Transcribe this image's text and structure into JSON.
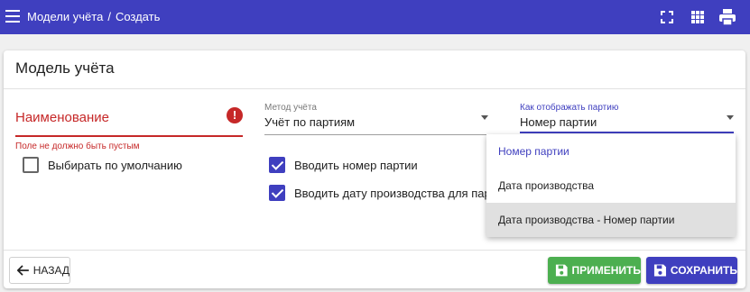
{
  "header": {
    "breadcrumb": [
      "Модели учёта",
      "Создать"
    ],
    "breadcrumb_separator": "/",
    "icons": [
      "menu-icon",
      "fullscreen-icon",
      "apps-grid-icon",
      "print-icon"
    ],
    "bar_color": "#3f3fbf"
  },
  "card": {
    "title": "Модель учёта"
  },
  "form": {
    "name_label": "Наименование",
    "name_value": "",
    "name_error": "Поле не должно быть пустым",
    "default_checkbox": {
      "label": "Выбирать по умолчанию",
      "checked": false
    },
    "method": {
      "caption": "Метод учёта",
      "value": "Учёт по партиям"
    },
    "batch_number_checkbox": {
      "label": "Вводить номер партии",
      "checked": true
    },
    "production_date_checkbox": {
      "label": "Вводить дату производства для партии",
      "checked": true
    },
    "display": {
      "caption": "Как отображать партию",
      "value": "Номер партии"
    },
    "display_options": [
      "Номер партии",
      "Дата производства",
      "Дата производства - Номер партии"
    ],
    "display_selected_index": 0,
    "display_highlighted_index": 2
  },
  "footer": {
    "back_label": "НАЗАД",
    "apply_label": "ПРИМЕНИТЬ",
    "save_label": "СОХРАНИТЬ"
  },
  "colors": {
    "accent": "#3f3fbf",
    "error": "#c62828",
    "apply": "#4caf50"
  }
}
